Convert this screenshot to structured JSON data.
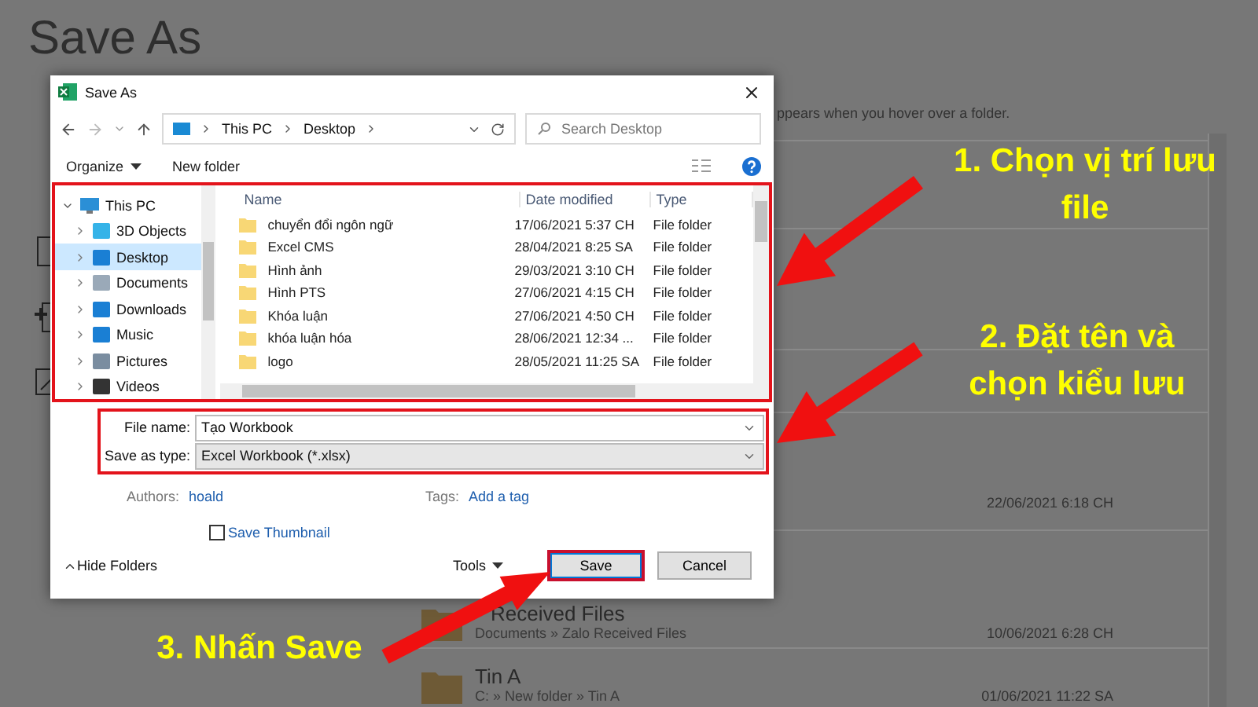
{
  "backstage": {
    "title": "Save As",
    "hint": "ppears when you hover over a folder.",
    "items": [
      {
        "date": "22/06/2021 6:18 CH"
      },
      {
        "name": "Received Files",
        "path": "Documents » Zalo Received Files",
        "date": "10/06/2021 6:28 CH"
      },
      {
        "name": "Tin A",
        "path": "C: » New folder » Tin A",
        "date": "01/06/2021 11:22 SA"
      }
    ]
  },
  "dialog": {
    "title": "Save As",
    "address": {
      "crumbs": [
        "This PC",
        "Desktop"
      ]
    },
    "search": {
      "placeholder": "Search Desktop"
    },
    "toolbar": {
      "organize": "Organize",
      "new_folder": "New folder"
    },
    "browse": {
      "highlighted": true,
      "tree": {
        "label": "This PC",
        "expanded": true,
        "selected": false,
        "children": [
          {
            "label": "3D Objects",
            "selected": false
          },
          {
            "label": "Desktop",
            "selected": true
          },
          {
            "label": "Documents",
            "selected": false
          },
          {
            "label": "Downloads",
            "selected": false
          },
          {
            "label": "Music",
            "selected": false
          },
          {
            "label": "Pictures",
            "selected": false
          },
          {
            "label": "Videos",
            "selected": false
          }
        ]
      },
      "columns": [
        "Name",
        "Date modified",
        "Type"
      ],
      "rows": [
        {
          "name": "chuyển đổi ngôn ngữ",
          "date": "17/06/2021 5:37 CH",
          "type": "File folder"
        },
        {
          "name": "Excel CMS",
          "date": "28/04/2021 8:25 SA",
          "type": "File folder"
        },
        {
          "name": "Hình ảnh",
          "date": "29/03/2021 3:10 CH",
          "type": "File folder"
        },
        {
          "name": "Hình PTS",
          "date": "27/06/2021 4:15 CH",
          "type": "File folder"
        },
        {
          "name": "Khóa luận",
          "date": "27/06/2021 4:50 CH",
          "type": "File folder"
        },
        {
          "name": "khóa luận hóa",
          "date": "28/06/2021 12:34 ...",
          "type": "File folder"
        },
        {
          "name": "logo",
          "date": "28/05/2021 11:25 SA",
          "type": "File folder"
        }
      ]
    },
    "fields": {
      "highlighted": true,
      "items": [
        {
          "label": "File name:",
          "value": "Tạo Workbook",
          "kind": "text"
        },
        {
          "label": "Save as type:",
          "value": "Excel Workbook (*.xlsx)",
          "kind": "select"
        }
      ]
    },
    "meta": [
      {
        "label": "Authors:",
        "value": "hoald"
      },
      {
        "label": "Tags:",
        "value": "Add a tag"
      }
    ],
    "thumbnail": {
      "label": "Save Thumbnail",
      "checked": false
    },
    "hide_folders": "Hide Folders",
    "tools": "Tools",
    "buttons": [
      {
        "label": "Save",
        "highlighted": true
      },
      {
        "label": "Cancel",
        "highlighted": false
      }
    ]
  },
  "annotations": [
    {
      "lines": [
        "1. Chọn vị trí lưu",
        "file"
      ]
    },
    {
      "lines": [
        "2. Đặt tên và",
        "chọn kiểu lưu"
      ]
    },
    {
      "lines": [
        "3. Nhấn Save"
      ]
    }
  ]
}
